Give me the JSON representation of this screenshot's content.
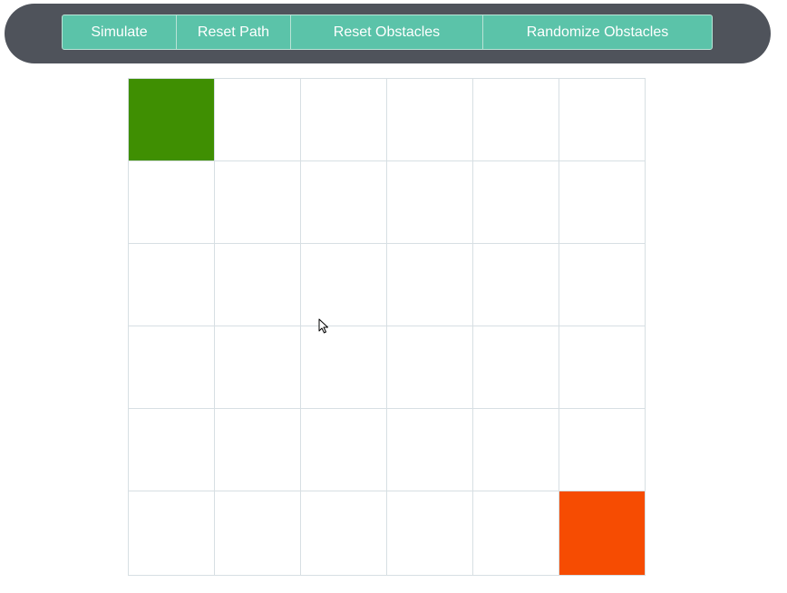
{
  "toolbar": {
    "buttons": [
      {
        "id": "simulate",
        "label": "Simulate"
      },
      {
        "id": "reset-path",
        "label": "Reset Path"
      },
      {
        "id": "reset-obstacles",
        "label": "Reset Obstacles"
      },
      {
        "id": "randomize-obstacles",
        "label": "Randomize Obstacles"
      }
    ]
  },
  "grid": {
    "rows": 6,
    "cols": 6,
    "start": {
      "row": 0,
      "col": 0
    },
    "end": {
      "row": 5,
      "col": 5
    },
    "colors": {
      "start": "#3f8f02",
      "end": "#f64c02",
      "empty": "#ffffff",
      "gridline": "#d7dfe3"
    }
  }
}
